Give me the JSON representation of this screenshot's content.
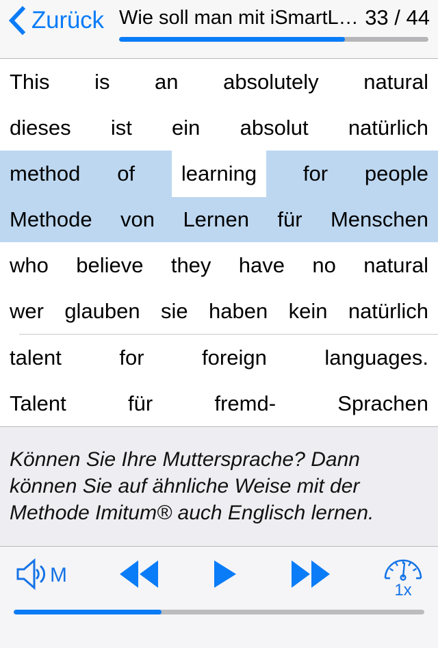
{
  "header": {
    "back_label": "Zurück",
    "back_icon": "chevron-left-icon",
    "doc_title": "Wie soll man mit iSmartL…",
    "page_counter": "33 / 44",
    "progress_percent": 73,
    "accent_color": "#0a7cf7"
  },
  "pairs": {
    "blocks": [
      {
        "highlighted": false,
        "separator_after": false,
        "cells": [
          {
            "source": "This",
            "target": "dieses",
            "selected": false
          },
          {
            "source": "is",
            "target": "ist",
            "selected": false
          },
          {
            "source": "an",
            "target": "ein",
            "selected": false
          },
          {
            "source": "absolutely",
            "target": "absolut",
            "selected": false
          },
          {
            "source": "natural",
            "target": "natürlich",
            "selected": false
          }
        ]
      },
      {
        "highlighted": true,
        "separator_after": false,
        "cells": [
          {
            "source": "method",
            "target": "Methode",
            "selected": false
          },
          {
            "source": "of",
            "target": "von",
            "selected": false
          },
          {
            "source": "learning",
            "target": "Lernen",
            "selected": true
          },
          {
            "source": "for",
            "target": "für",
            "selected": false
          },
          {
            "source": "people",
            "target": "Menschen",
            "selected": false
          }
        ]
      },
      {
        "highlighted": false,
        "separator_after": true,
        "cells": [
          {
            "source": "who",
            "target": "wer",
            "selected": false
          },
          {
            "source": "believe",
            "target": "glauben",
            "selected": false
          },
          {
            "source": "they",
            "target": "sie",
            "selected": false
          },
          {
            "source": "have",
            "target": "haben",
            "selected": false
          },
          {
            "source": "no",
            "target": "kein",
            "selected": false
          },
          {
            "source": "natural",
            "target": "natürlich",
            "selected": false
          }
        ]
      },
      {
        "highlighted": false,
        "separator_after": false,
        "cells": [
          {
            "source": "talent",
            "target": "Talent",
            "selected": false
          },
          {
            "source": "for",
            "target": "für",
            "selected": false
          },
          {
            "source": "foreign",
            "target": "fremd-",
            "selected": false
          },
          {
            "source": "languages.",
            "target": "Sprachen",
            "selected": false
          }
        ]
      }
    ]
  },
  "note": {
    "text": "Können Sie Ihre Muttersprache? Dann können Sie auf ähnliche Weise mit der Methode Imitum® auch Englisch lernen."
  },
  "toolbar": {
    "speaker_icon": "speaker-wave-icon",
    "speaker_label": "M",
    "rewind_icon": "rewind-icon",
    "play_icon": "play-icon",
    "fast_forward_icon": "fast-forward-icon",
    "speed_icon": "speedometer-icon",
    "speed_label": "1x",
    "progress_percent": 36,
    "accent_color": "#0a7cf7"
  }
}
